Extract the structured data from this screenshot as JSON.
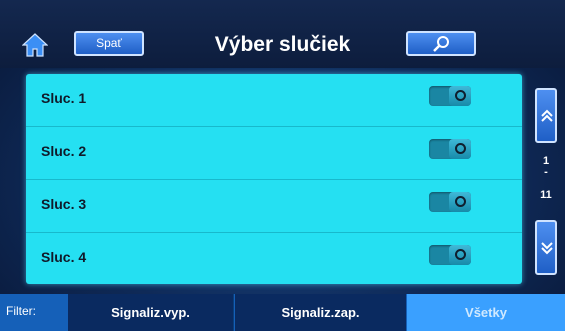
{
  "header": {
    "back_label": "Spať",
    "title": "Výber slučiek"
  },
  "loops": [
    {
      "label": "Sluc. 1",
      "enabled": true
    },
    {
      "label": "Sluc. 2",
      "enabled": true
    },
    {
      "label": "Sluc. 3",
      "enabled": true
    },
    {
      "label": "Sluc. 4",
      "enabled": true
    }
  ],
  "pager": {
    "current": "1",
    "separator": "-",
    "total": "11"
  },
  "filter": {
    "label": "Filter:",
    "tabs": [
      {
        "label": "Signaliz.vyp.",
        "selected": false
      },
      {
        "label": "Signaliz.zap.",
        "selected": false
      },
      {
        "label": "Všetky",
        "selected": true
      }
    ]
  },
  "colors": {
    "list_background": "#25e0f2",
    "button_blue": "#1f5fc6",
    "filter_selected": "#3aa0ff",
    "filter_unselected": "#0a2a60"
  },
  "icons": {
    "home": "home-icon",
    "search": "search-icon",
    "scroll_up": "double-chevron-up-icon",
    "scroll_down": "double-chevron-down-icon"
  }
}
